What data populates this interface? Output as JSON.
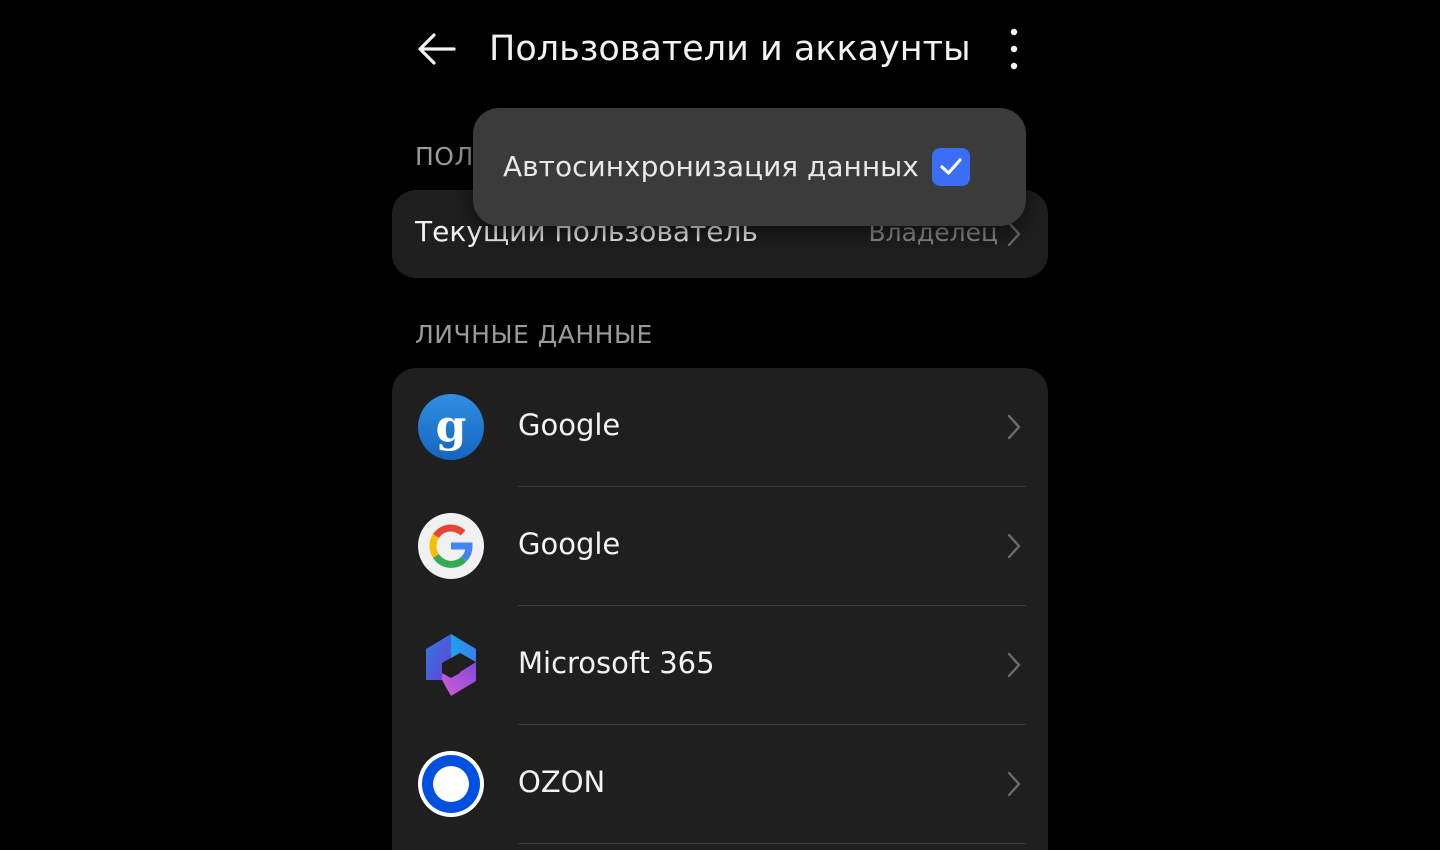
{
  "header": {
    "title": "Пользователи и аккаунты",
    "back_icon": "arrow-left-icon",
    "more_icon": "more-vertical-icon"
  },
  "sections": {
    "users_label_visible": "ПОЛ",
    "personal_label": "ЛИЧНЫЕ ДАННЫЕ"
  },
  "current_user": {
    "label": "Текущий пользователь",
    "value": "Владелец"
  },
  "accounts": [
    {
      "name": "Google",
      "icon": "google-g-blue-icon"
    },
    {
      "name": "Google",
      "icon": "google-g-color-icon"
    },
    {
      "name": "Microsoft 365",
      "icon": "microsoft-365-icon"
    },
    {
      "name": "OZON",
      "icon": "ozon-icon"
    }
  ],
  "popup": {
    "item_label": "Автосинхронизация данных",
    "checked": true
  },
  "colors": {
    "background": "#000000",
    "card": "#1f1f1f",
    "popup": "#3b3b3b",
    "accent": "#3b6ef5",
    "secondary_text": "#9a9a9a"
  }
}
